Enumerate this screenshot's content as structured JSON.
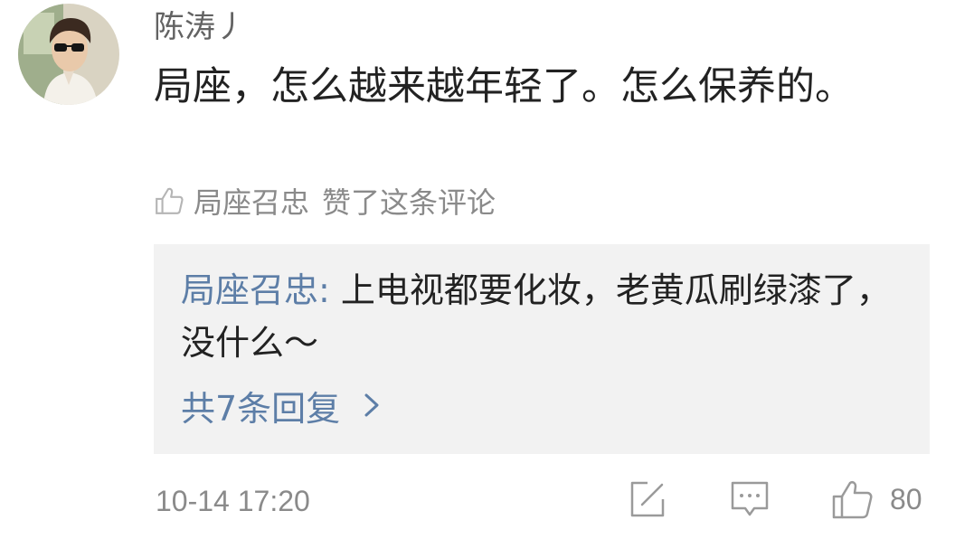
{
  "comment": {
    "author": "陈涛丿",
    "text": "局座，怎么越来越年轻了。怎么保养的。",
    "liked_by": "局座召忠",
    "liked_suffix": "赞了这条评论"
  },
  "reply": {
    "author": "局座召忠:",
    "text": " 上电视都要化妆，老黄瓜刷绿漆了，没什么～",
    "more_label": "共7条回复"
  },
  "footer": {
    "timestamp": "10-14 17:20",
    "like_count": "80"
  },
  "icons": {
    "liked": "thumbs-up-outline-icon",
    "more": "chevron-right-icon",
    "repost": "edit-share-icon",
    "comment": "comment-bubble-icon",
    "like": "thumbs-up-icon"
  },
  "colors": {
    "link_blue": "#5d7ea7",
    "secondary_gray": "#8a8a8a",
    "reply_background": "#f2f2f2",
    "text_dark": "#222222"
  }
}
